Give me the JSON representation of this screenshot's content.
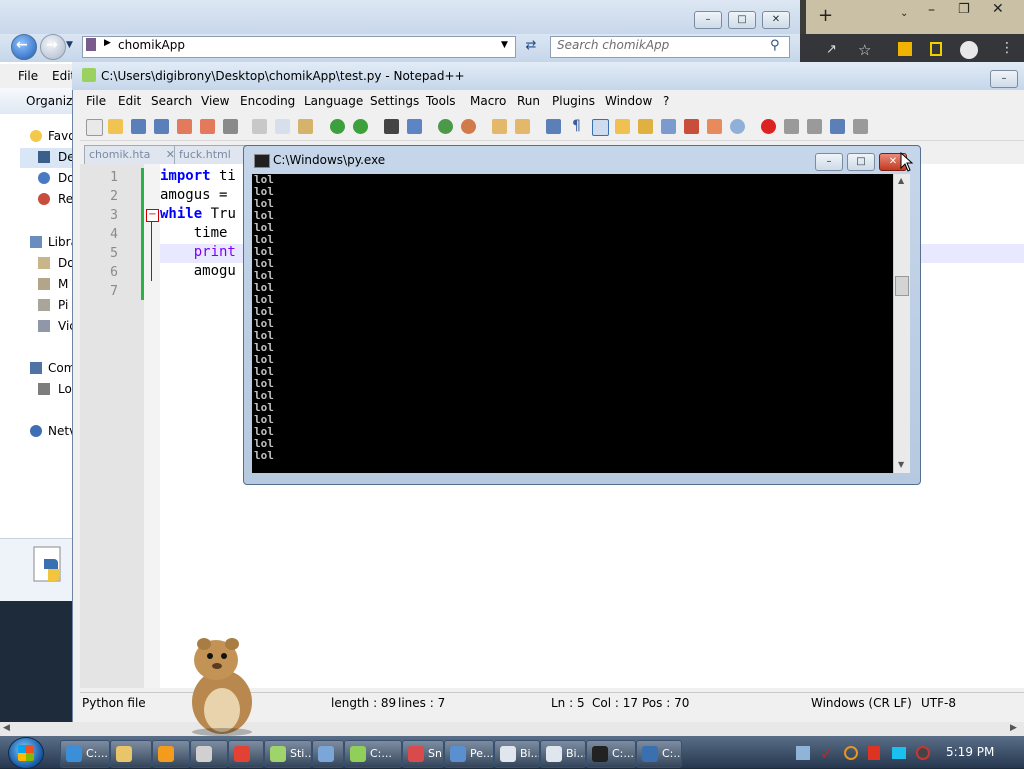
{
  "explorer": {
    "address": "chomikApp",
    "search_placeholder": "Search chomikApp",
    "menu": [
      "File",
      "Edit"
    ],
    "organize_label": "Organize",
    "nav_items": [
      {
        "label": "Favo",
        "icon": "star-icon"
      },
      {
        "label": "De",
        "icon": "desktop-icon"
      },
      {
        "label": "Do",
        "icon": "downloads-icon"
      },
      {
        "label": "Re",
        "icon": "recent-places-icon"
      },
      {
        "label": "Libra",
        "icon": "libraries-icon"
      },
      {
        "label": "Do",
        "icon": "documents-icon"
      },
      {
        "label": "M",
        "icon": "music-icon"
      },
      {
        "label": "Pi",
        "icon": "pictures-icon"
      },
      {
        "label": "Vic",
        "icon": "videos-icon"
      },
      {
        "label": "Com",
        "icon": "computer-icon"
      },
      {
        "label": "Lo",
        "icon": "local-disk-icon"
      },
      {
        "label": "Netv",
        "icon": "network-icon"
      }
    ]
  },
  "notepad": {
    "title": "C:\\Users\\digibrony\\Desktop\\chomikApp\\test.py - Notepad++",
    "menu": [
      "File",
      "Edit",
      "Search",
      "View",
      "Encoding",
      "Language",
      "Settings",
      "Tools",
      "Macro",
      "Run",
      "Plugins",
      "Window",
      "?"
    ],
    "tabs": [
      "chomik.hta",
      "fuck.html"
    ],
    "line_numbers": [
      "1",
      "2",
      "3",
      "4",
      "5",
      "6",
      "7"
    ],
    "code_lines": [
      {
        "kw": "import",
        "rest": " ti"
      },
      {
        "kw": "",
        "rest": "amogus ="
      },
      {
        "kw": "while",
        "rest": " Tru"
      },
      {
        "kw": "",
        "rest": "    time"
      },
      {
        "kw": "",
        "rest": "    print"
      },
      {
        "kw": "",
        "rest": "    amogu"
      },
      {
        "kw": "",
        "rest": ""
      }
    ],
    "status": {
      "file_type": "Python file",
      "length": "length : 89",
      "lines": "lines : 7",
      "ln": "Ln : 5",
      "col": "Col : 17",
      "pos": "Pos : 70",
      "eol": "Windows (CR LF)",
      "encoding": "UTF-8"
    }
  },
  "console": {
    "title": "C:\\Windows\\py.exe",
    "line_text": "lol",
    "line_count": 24
  },
  "taskbar": {
    "items": [
      {
        "label": "C:...",
        "icon": "ie-icon",
        "color": "#3b8fd9"
      },
      {
        "label": "",
        "icon": "folder-icon",
        "color": "#e8c46a"
      },
      {
        "label": "",
        "icon": "media-player-icon",
        "color": "#f29b1d"
      },
      {
        "label": "",
        "icon": "calculator-icon",
        "color": "#d0d0d0"
      },
      {
        "label": "",
        "icon": "chrome-icon",
        "color": "#e34133"
      },
      {
        "label": "Sti...",
        "icon": "sticky-notes-icon",
        "color": "#9fd36b"
      },
      {
        "label": "",
        "icon": "explorer-icon",
        "color": "#7aa7d8"
      },
      {
        "label": "C:...",
        "icon": "notepadpp-icon",
        "color": "#8fcf5a"
      },
      {
        "label": "Sn...",
        "icon": "snipping-icon",
        "color": "#d94a4a"
      },
      {
        "label": "Pe...",
        "icon": "paint-icon",
        "color": "#5a8fd0"
      },
      {
        "label": "Bi...",
        "icon": "window-icon",
        "color": "#dfe6ee"
      },
      {
        "label": "Bi...",
        "icon": "window-icon",
        "color": "#dfe6ee"
      },
      {
        "label": "C:...",
        "icon": "7zip-icon",
        "color": "#222222"
      },
      {
        "label": "C:...",
        "icon": "python-icon",
        "color": "#3a6fb0"
      }
    ],
    "clock": "5:19 PM"
  }
}
